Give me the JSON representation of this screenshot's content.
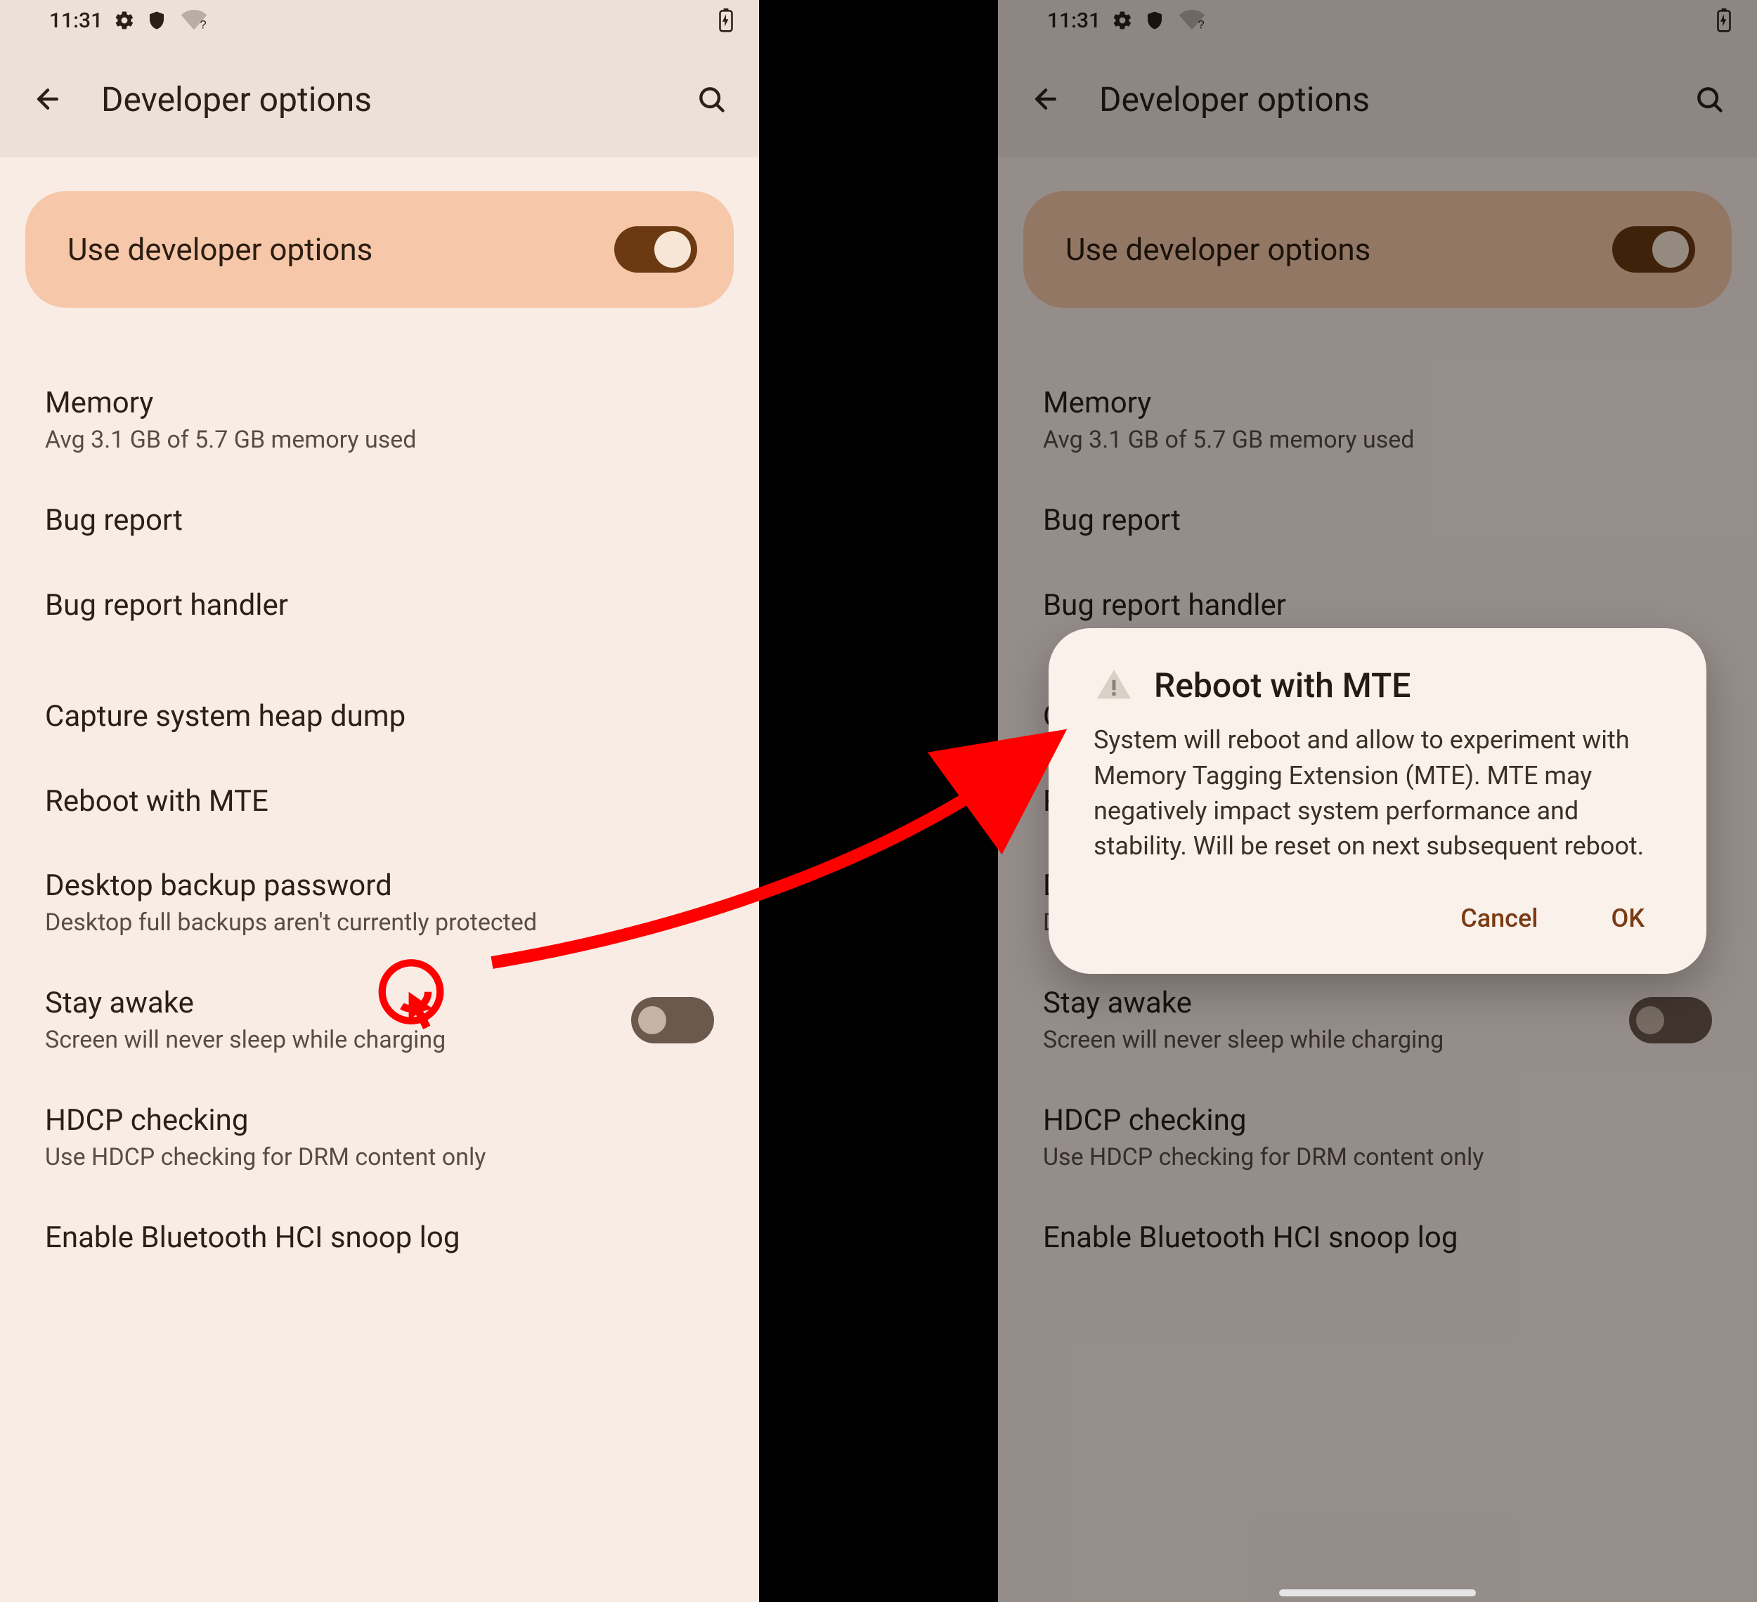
{
  "statusbar": {
    "time": "11:31"
  },
  "appbar": {
    "title": "Developer options"
  },
  "master_toggle": {
    "label": "Use developer options",
    "on": true
  },
  "items": [
    {
      "primary": "Memory",
      "secondary": "Avg 3.1 GB of 5.7 GB memory used"
    },
    {
      "primary": "Bug report"
    },
    {
      "primary": "Bug report handler"
    },
    {
      "primary": "Capture system heap dump"
    },
    {
      "primary": "Reboot with MTE"
    },
    {
      "primary": "Desktop backup password",
      "secondary": "Desktop full backups aren't currently protected"
    },
    {
      "primary": "Stay awake",
      "secondary": "Screen will never sleep while charging",
      "switch": false
    },
    {
      "primary": "HDCP checking",
      "secondary": "Use HDCP checking for DRM content only"
    },
    {
      "primary": "Enable Bluetooth HCI snoop log"
    }
  ],
  "dialog": {
    "title": "Reboot with MTE",
    "body": "System will reboot and allow to experiment with Memory Tagging Extension (MTE). MTE may negatively impact system performance and stability. Will be reset on next subsequent reboot.",
    "cancel": "Cancel",
    "ok": "OK"
  },
  "colors": {
    "accent": "#7a3b14",
    "annotation": "#ff0000"
  }
}
